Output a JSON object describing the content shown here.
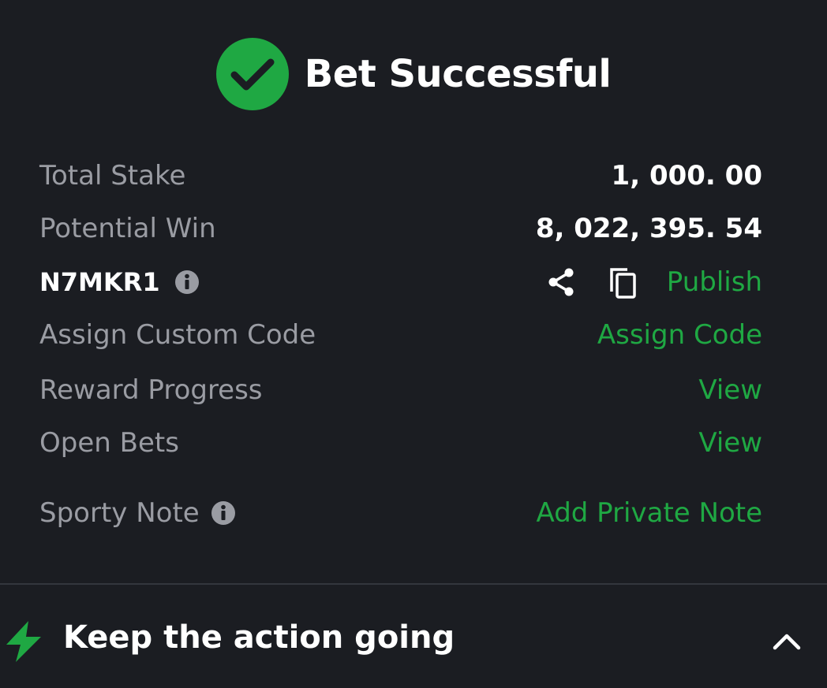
{
  "header": {
    "title": "Bet Successful",
    "icon": "check-circle-icon",
    "accent": "#1fa843"
  },
  "summary": {
    "total_stake_label": "Total Stake",
    "total_stake_value": "1, 000. 00",
    "potential_win_label": "Potential Win",
    "potential_win_value": "8, 022, 395. 54",
    "booking_code": "N7MKR1",
    "publish_label": "Publish",
    "assign_custom_code_label": "Assign Custom Code",
    "assign_code_link": "Assign Code",
    "reward_progress_label": "Reward Progress",
    "reward_progress_link": "View",
    "open_bets_label": "Open Bets",
    "open_bets_link": "View",
    "sporty_note_label": "Sporty Note",
    "add_private_note_link": "Add Private Note"
  },
  "footer": {
    "title": "Keep the action going",
    "icon": "lightning-bolt-icon",
    "toggle_icon": "chevron-up-icon"
  },
  "colors": {
    "background": "#1b1d22",
    "label": "#9a9ca3",
    "link": "#1fa843",
    "text": "#ffffff",
    "divider": "#33363d"
  }
}
